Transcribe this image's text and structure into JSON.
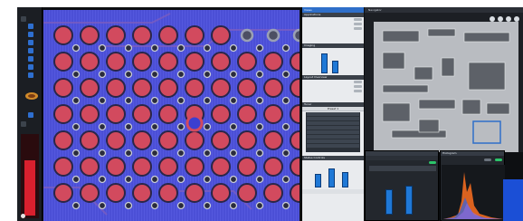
{
  "toolbar": {
    "logo": "",
    "meter_level": 0.7
  },
  "panels": {
    "column_title": "Views",
    "applications": {
      "header": "Applications",
      "rows": [
        {
          "label": "",
          "value": ""
        },
        {
          "label": "",
          "value": ""
        },
        {
          "label": "",
          "value": ""
        }
      ]
    },
    "imaging": {
      "header": "Imaging",
      "title": "",
      "bar_levels": [
        0.85,
        0.55
      ]
    },
    "layout": {
      "header": "Layout Overview",
      "rows": [
        {
          "label": "",
          "value": ""
        },
        {
          "label": "",
          "value": ""
        },
        {
          "label": "",
          "value": ""
        }
      ]
    },
    "tuner": {
      "header": "Tuner",
      "title": "Preset 1"
    },
    "status": {
      "header": "Status Controls",
      "bar_levels": [
        0.55,
        0.75,
        0.6
      ],
      "labels": [
        "",
        "",
        ""
      ]
    }
  },
  "navigator": {
    "title": "Navigator"
  },
  "windows": {
    "left": {
      "title": "",
      "bar_levels": [
        0.7,
        0.8
      ]
    },
    "right": {
      "title": "Histogram"
    }
  },
  "colors": {
    "accent": "#2f6fc9",
    "scan_blue": "#4a4fd8",
    "pad_red": "#d24a5e",
    "histogram_orange": "#f06a20"
  }
}
